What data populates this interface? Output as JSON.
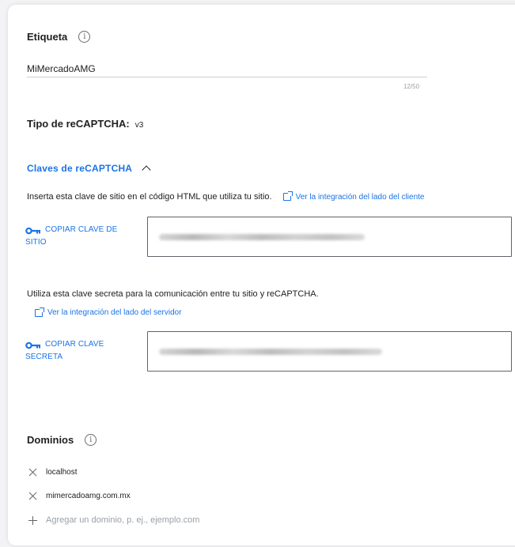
{
  "label_section": {
    "title": "Etiqueta",
    "value": "MiMercadoAMG",
    "counter": "12/50"
  },
  "recaptcha_type": {
    "label": "Tipo de reCAPTCHA:",
    "value": "v3"
  },
  "keys": {
    "toggle_label": "Claves de reCAPTCHA",
    "site_key": {
      "description": "Inserta esta clave de sitio en el código HTML que utiliza tu sitio.",
      "integration_link": "Ver la integración del lado del cliente",
      "copy_line1": "COPIAR CLAVE DE",
      "copy_line2": "SITIO"
    },
    "secret_key": {
      "description": "Utiliza esta clave secreta para la comunicación entre tu sitio y reCAPTCHA.",
      "integration_link": "Ver la integración del lado del servidor",
      "copy_line1": "COPIAR CLAVE",
      "copy_line2": "SECRETA"
    }
  },
  "domains": {
    "title": "Dominios",
    "items": [
      "localhost",
      "mimercadoamg.com.mx"
    ],
    "add_placeholder": "Agregar un dominio, p. ej., ejemplo.com"
  },
  "colors": {
    "accent": "#1a73e8",
    "text": "#202124",
    "muted": "#9aa0a6"
  }
}
